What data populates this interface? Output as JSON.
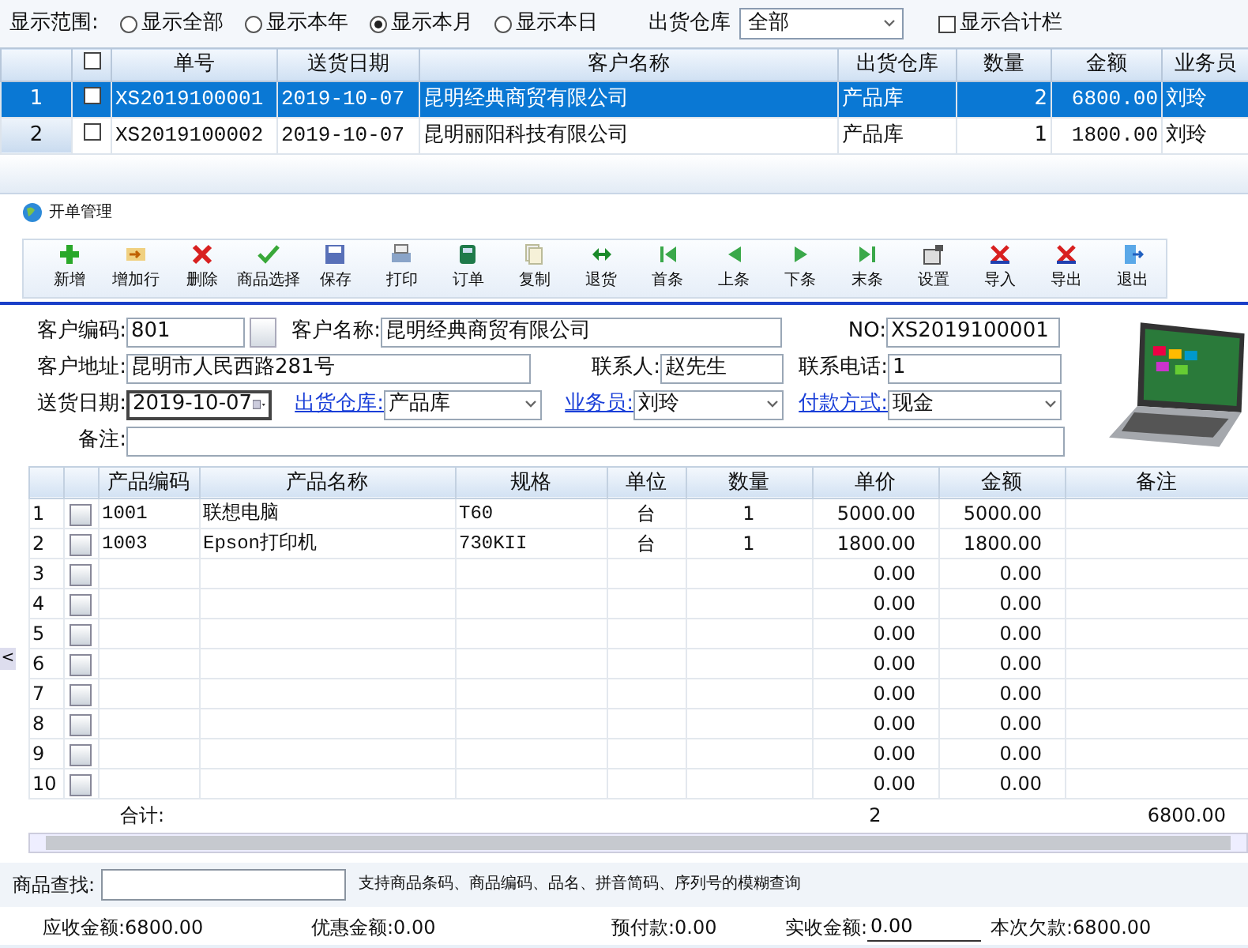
{
  "filter_bar": {
    "label": "显示范围:",
    "options": [
      {
        "label": "显示全部",
        "selected": false
      },
      {
        "label": "显示本年",
        "selected": false
      },
      {
        "label": "显示本月",
        "selected": true
      },
      {
        "label": "显示本日",
        "selected": false
      }
    ],
    "warehouse_label": "出货仓库",
    "warehouse_value": "全部",
    "totals_checkbox": {
      "label": "显示合计栏",
      "checked": false
    }
  },
  "orders": {
    "header_checked": false,
    "columns": [
      "单号",
      "送货日期",
      "客户名称",
      "出货仓库",
      "数量",
      "金额",
      "业务员"
    ],
    "rows": [
      {
        "index": "1",
        "selected": true,
        "checked": false,
        "cells": [
          "XS2019100001",
          "2019-10-07",
          "昆明经典商贸有限公司",
          "产品库",
          "2",
          "6800.00",
          "刘玲"
        ]
      },
      {
        "index": "2",
        "selected": false,
        "checked": false,
        "cells": [
          "XS2019100002",
          "2019-10-07",
          "昆明丽阳科技有限公司",
          "产品库",
          "1",
          "1800.00",
          "刘玲"
        ]
      }
    ]
  },
  "window": {
    "title": "开单管理"
  },
  "toolbar": [
    {
      "kind": "plus",
      "label": "新增"
    },
    {
      "kind": "addrow",
      "label": "增加行"
    },
    {
      "kind": "delete",
      "label": "删除"
    },
    {
      "kind": "check",
      "label": "商品选择"
    },
    {
      "kind": "save",
      "label": "保存"
    },
    {
      "kind": "print",
      "label": "打印"
    },
    {
      "kind": "order",
      "label": "订单"
    },
    {
      "kind": "copy",
      "label": "复制"
    },
    {
      "kind": "return",
      "label": "退货"
    },
    {
      "kind": "first",
      "label": "首条"
    },
    {
      "kind": "prev",
      "label": "上条"
    },
    {
      "kind": "next",
      "label": "下条"
    },
    {
      "kind": "last",
      "label": "末条"
    },
    {
      "kind": "settings",
      "label": "设置"
    },
    {
      "kind": "import",
      "label": "导入"
    },
    {
      "kind": "export",
      "label": "导出"
    },
    {
      "kind": "exit",
      "label": "退出"
    }
  ],
  "form": [
    [
      {
        "kind": "lookup",
        "label": "客户编码:",
        "link": false,
        "value": "801"
      },
      {
        "kind": "text",
        "label": "客户名称:",
        "link": false,
        "value": "昆明经典商贸有限公司"
      },
      {
        "kind": "text",
        "label": "NO:",
        "link": false,
        "value": "XS2019100001"
      }
    ],
    [
      {
        "kind": "text",
        "label": "客户地址:",
        "link": false,
        "value": "昆明市人民西路281号"
      },
      {
        "kind": "text",
        "label": "联系人:",
        "link": false,
        "value": "赵先生"
      },
      {
        "kind": "text",
        "label": "联系电话:",
        "link": false,
        "value": "1"
      }
    ],
    [
      {
        "kind": "date",
        "label": "送货日期:",
        "link": false,
        "value": "2019-10-07"
      },
      {
        "kind": "select",
        "label": "出货仓库:",
        "link": true,
        "value": "产品库"
      },
      {
        "kind": "select",
        "label": "业务员:",
        "link": true,
        "value": "刘玲"
      },
      {
        "kind": "select",
        "label": "付款方式:",
        "link": true,
        "value": "现金"
      }
    ],
    [
      {
        "kind": "text",
        "label": "备注:",
        "link": false
      }
    ]
  ],
  "items": {
    "columns": [
      "产品编码",
      "产品名称",
      "规格",
      "单位",
      "数量",
      "单价",
      "金额",
      "备注"
    ],
    "rows": [
      {
        "index": "1",
        "cells": [
          "1001",
          "联想电脑",
          "T60",
          "台",
          "1",
          "5000.00",
          "5000.00"
        ]
      },
      {
        "index": "2",
        "cells": [
          "1003",
          "Epson打印机",
          "730KII",
          "台",
          "1",
          "1800.00",
          "1800.00"
        ]
      },
      {
        "index": "3",
        "cells": [
          "",
          "",
          "",
          "",
          "",
          "0.00",
          "0.00"
        ]
      },
      {
        "index": "4",
        "cells": [
          "",
          "",
          "",
          "",
          "",
          "0.00",
          "0.00"
        ]
      },
      {
        "index": "5",
        "cells": [
          "",
          "",
          "",
          "",
          "",
          "0.00",
          "0.00"
        ]
      },
      {
        "index": "6",
        "cells": [
          "",
          "",
          "",
          "",
          "",
          "0.00",
          "0.00"
        ]
      },
      {
        "index": "7",
        "cells": [
          "",
          "",
          "",
          "",
          "",
          "0.00",
          "0.00"
        ]
      },
      {
        "index": "8",
        "cells": [
          "",
          "",
          "",
          "",
          "",
          "0.00",
          "0.00"
        ]
      },
      {
        "index": "9",
        "cells": [
          "",
          "",
          "",
          "",
          "",
          "0.00",
          "0.00"
        ]
      },
      {
        "index": "10",
        "cells": [
          "",
          "",
          "",
          "",
          "",
          "0.00",
          "0.00"
        ]
      }
    ],
    "footer_label": "合计:",
    "footer_qty": "2",
    "footer_amount": "6800.00"
  },
  "side_toggle": "<",
  "search": {
    "label": "商品查找:",
    "hint": "支持商品条码、商品编码、品名、拼音简码、序列号的模糊查询"
  },
  "totals": [
    {
      "kind": "text",
      "text": "应收金额:6800.00"
    },
    {
      "kind": "text",
      "text": "优惠金额:0.00"
    },
    {
      "kind": "text",
      "text": "预付款:0.00"
    },
    {
      "kind": "input",
      "label": "实收金额:",
      "value": "0.00"
    },
    {
      "kind": "text",
      "text": "本次欠款:6800.00"
    }
  ]
}
